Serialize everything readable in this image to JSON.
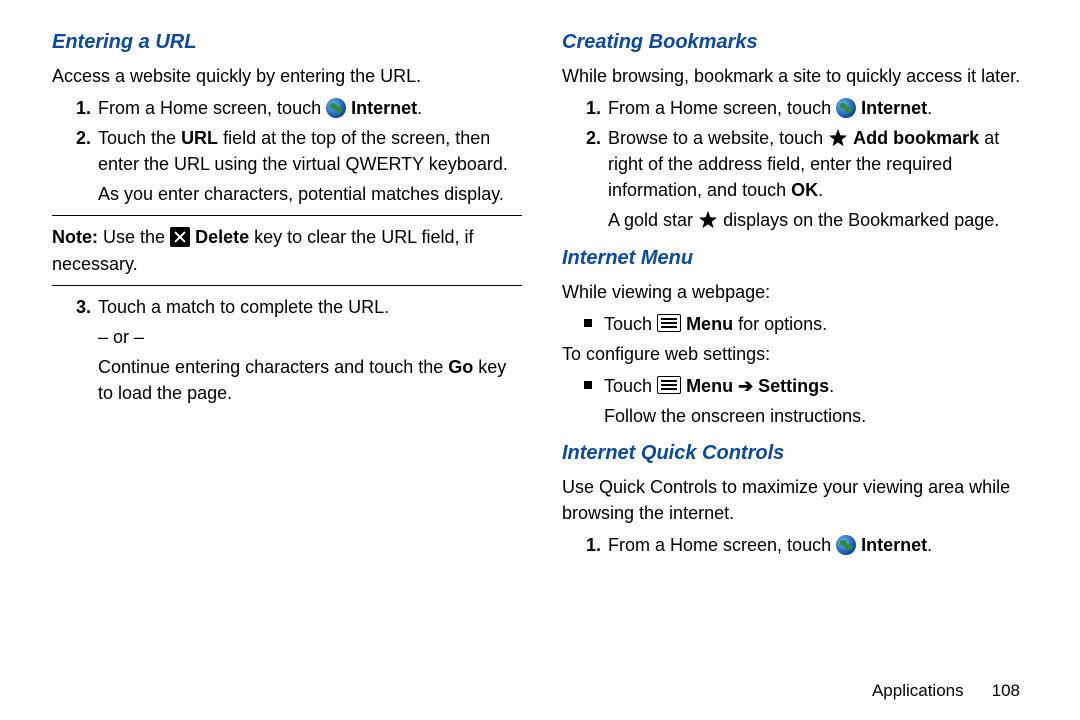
{
  "left": {
    "h1": "Entering a URL",
    "intro": "Access a website quickly by entering the URL.",
    "step1_a": "From a Home screen, touch ",
    "step1_b": "Internet",
    "step1_c": ".",
    "step2_a": "Touch the ",
    "step2_url": "URL",
    "step2_b": " field at the top of the screen, then enter the URL using the virtual QWERTY keyboard.",
    "step2_sub": "As you enter characters, potential matches display.",
    "note_label": "Note:",
    "note_a": " Use the ",
    "note_del": "Delete",
    "note_b": " key to clear the URL field, if necessary.",
    "step3_a": "Touch a match to complete the URL.",
    "or": "– or –",
    "step3_b_a": "Continue entering characters and touch the ",
    "step3_b_go": "Go",
    "step3_b_b": " key to load the page."
  },
  "right": {
    "h1": "Creating Bookmarks",
    "intro": "While browsing, bookmark a site to quickly access it later.",
    "s1_a": "From a Home screen, touch ",
    "s1_b": "Internet",
    "s1_c": ".",
    "s2_a": "Browse to a website, touch ",
    "s2_add": "Add bookmark",
    "s2_b": " at right of the address field, enter the required information, and touch ",
    "s2_ok": "OK",
    "s2_c": ".",
    "s2_sub_a": "A gold star ",
    "s2_sub_b": " displays on the Bookmarked page.",
    "h2": "Internet Menu",
    "im_p1": "While viewing a webpage:",
    "im_b1_a": "Touch ",
    "im_b1_menu": "Menu",
    "im_b1_b": " for options.",
    "im_p2": "To configure web settings:",
    "im_b2_a": "Touch ",
    "im_b2_menu": "Menu",
    "im_b2_arrow": " ➔ ",
    "im_b2_settings": "Settings",
    "im_b2_c": ".",
    "im_b2_sub": "Follow the onscreen instructions.",
    "h3": "Internet Quick Controls",
    "iqc_intro": "Use Quick Controls to maximize your viewing area while browsing the internet.",
    "iqc1_a": "From a Home screen, touch ",
    "iqc1_b": "Internet",
    "iqc1_c": "."
  },
  "footer": {
    "section": "Applications",
    "page": "108"
  },
  "icons": {
    "globe": "globe-icon",
    "x": "x-delete-icon",
    "star_blue": "star-blue-icon",
    "star_gold": "star-gold-icon",
    "menu": "menu-icon"
  }
}
